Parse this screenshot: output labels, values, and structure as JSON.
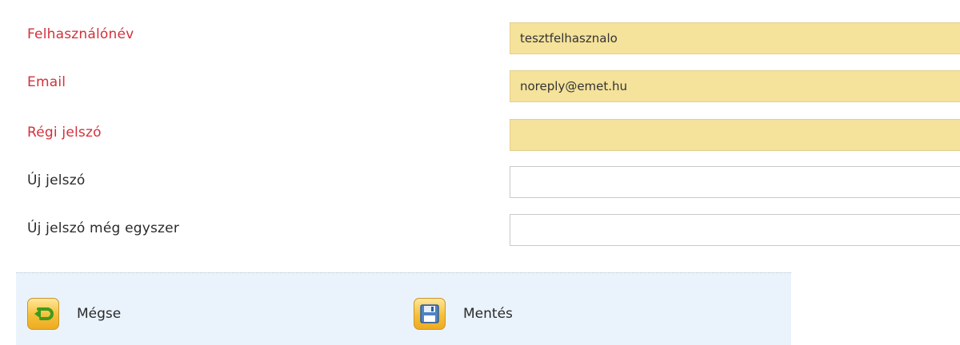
{
  "form": {
    "fields": [
      {
        "label": "Felhasználónév",
        "value": "tesztfelhasznalo",
        "required": true
      },
      {
        "label": "Email",
        "value": "noreply@emet.hu",
        "required": true
      },
      {
        "label": "Régi jelszó",
        "value": "",
        "required": true
      },
      {
        "label": "Új jelszó",
        "value": "",
        "required": false
      },
      {
        "label": "Új jelszó még egyszer",
        "value": "",
        "required": false
      }
    ]
  },
  "toolbar": {
    "cancel_label": "Mégse",
    "save_label": "Mentés"
  },
  "colors": {
    "required_label": "#d2313b",
    "required_field_bg": "#f5e29b",
    "toolbar_bg": "#eaf3fb",
    "button_icon_bg": "#f5bf3a"
  },
  "icons": {
    "cancel": "back-arrow-icon",
    "save": "floppy-disk-icon"
  }
}
